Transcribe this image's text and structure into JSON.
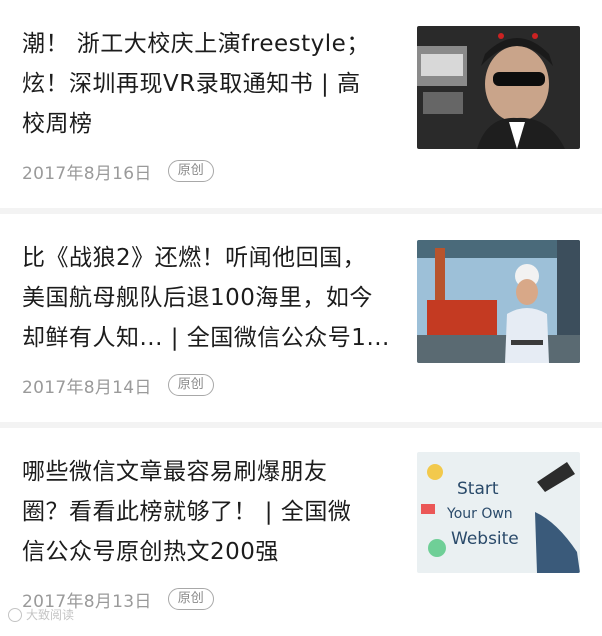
{
  "articles": [
    {
      "title": "潮！ 浙工大校庆上演freestyle；\n炫！深圳再现VR录取通知书 | 高\n校周榜",
      "date": "2017年8月16日",
      "badge": "原创",
      "thumb_icon": "student-photo"
    },
    {
      "title": "比《战狼2》还燃！听闻他回国，\n美国航母舰队后退100海里，如今\n却鲜有人知... | 全国微信公众号1...",
      "date": "2017年8月14日",
      "badge": "原创",
      "thumb_icon": "engineer-photo"
    },
    {
      "title": "哪些微信文章最容易刷爆朋友\n圈？看看此榜就够了！ | 全国微\n信公众号原创热文200强",
      "date": "2017年8月13日",
      "badge": "原创",
      "thumb_icon": "start-your-own-website-photo",
      "thumb_text": [
        "Start",
        "Your Own",
        "Website"
      ]
    }
  ],
  "watermark": "大致阅读",
  "colors": {
    "title": "#1c1c1c",
    "meta": "#9a9a9a",
    "divider": "#f3f3f3"
  }
}
